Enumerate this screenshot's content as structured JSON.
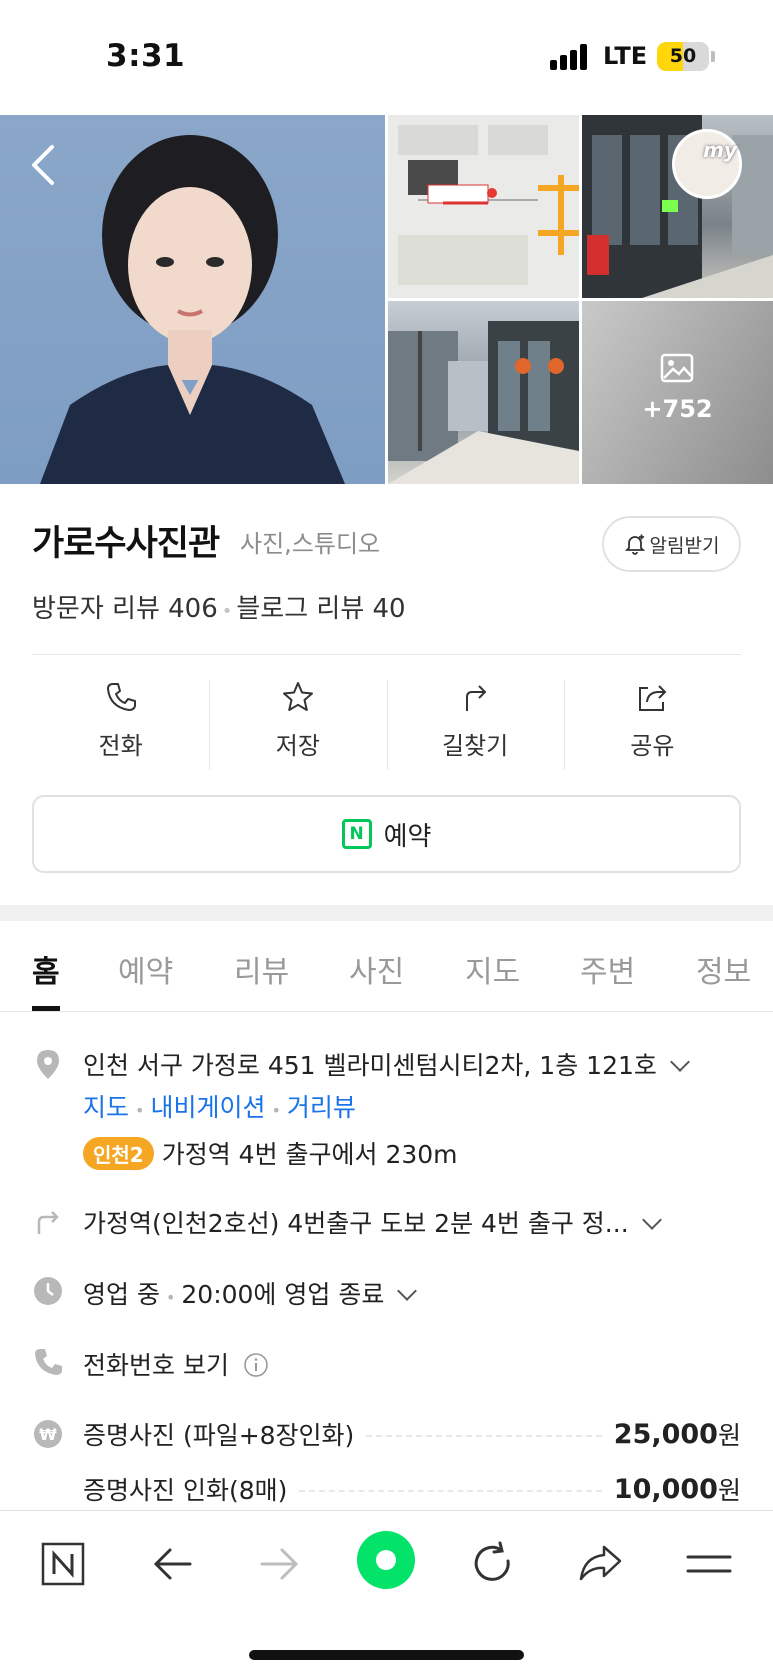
{
  "status_bar": {
    "time": "3:31",
    "network": "LTE",
    "battery": "50",
    "battery_level_percent": 50
  },
  "photos": {
    "more_count": "+752",
    "badge_text": "my"
  },
  "place": {
    "name": "가로수사진관",
    "category": "사진,스튜디오",
    "alarm_label": "알림받기",
    "visitor_reviews": "방문자 리뷰 406",
    "blog_reviews": "블로그 리뷰 40"
  },
  "actions": [
    {
      "label": "전화",
      "icon": "phone-icon"
    },
    {
      "label": "저장",
      "icon": "star-icon"
    },
    {
      "label": "길찾기",
      "icon": "directions-icon"
    },
    {
      "label": "공유",
      "icon": "share-icon"
    }
  ],
  "reserve": {
    "icon_text": "N",
    "label": "예약"
  },
  "tabs": [
    "홈",
    "예약",
    "리뷰",
    "사진",
    "지도",
    "주변",
    "정보"
  ],
  "details": {
    "address": "인천 서구 가정로 451 벨라미센텀시티2차, 1층 121호",
    "links": [
      "지도",
      "내비게이션",
      "거리뷰"
    ],
    "subway_line": "인천2",
    "subway_text": "가정역 4번 출구에서 230m",
    "directions": "가정역(인천2호선) 4번출구 도보 2분 4번 출구 정...",
    "hours_status": "영업 중",
    "hours_text": "20:00에 영업 종료",
    "phone": "전화번호 보기",
    "prices": [
      {
        "name": "증명사진 (파일+8장인화)",
        "price": "25,000",
        "unit": "원"
      },
      {
        "name": "증명사진 인화(8매)",
        "price": "10,000",
        "unit": "원"
      }
    ]
  },
  "colors": {
    "accent_green": "#03c75a",
    "link_blue": "#1a73e8",
    "subway_badge": "#f5a623",
    "battery": "#ffd60a"
  }
}
